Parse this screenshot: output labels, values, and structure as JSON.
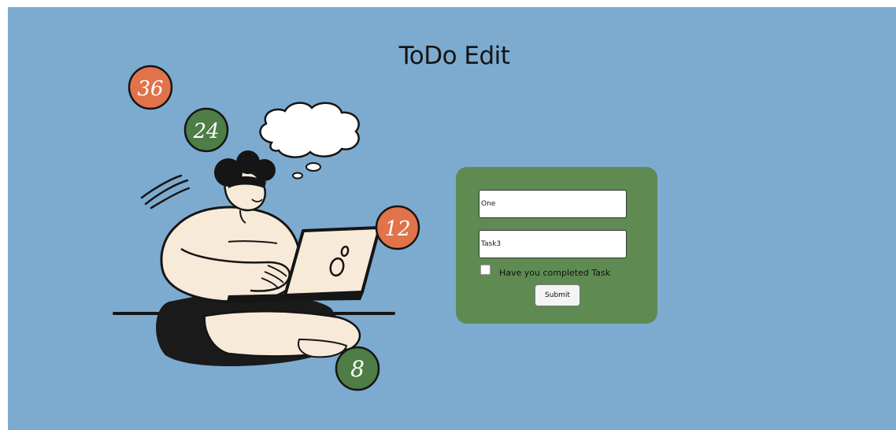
{
  "page": {
    "title": "ToDo Edit"
  },
  "illustration": {
    "badges": [
      "36",
      "24",
      "12",
      "8"
    ]
  },
  "form": {
    "name_value": "One",
    "task_value": "Task3",
    "completed_checked": false,
    "checkbox_label": "Have you completed Task",
    "submit_label": "Submit"
  },
  "colors": {
    "background": "#7dabd0",
    "card": "#5f8b53",
    "badge_orange": "#e0734a",
    "badge_green": "#4e7d45",
    "skin": "#f8ead8"
  }
}
